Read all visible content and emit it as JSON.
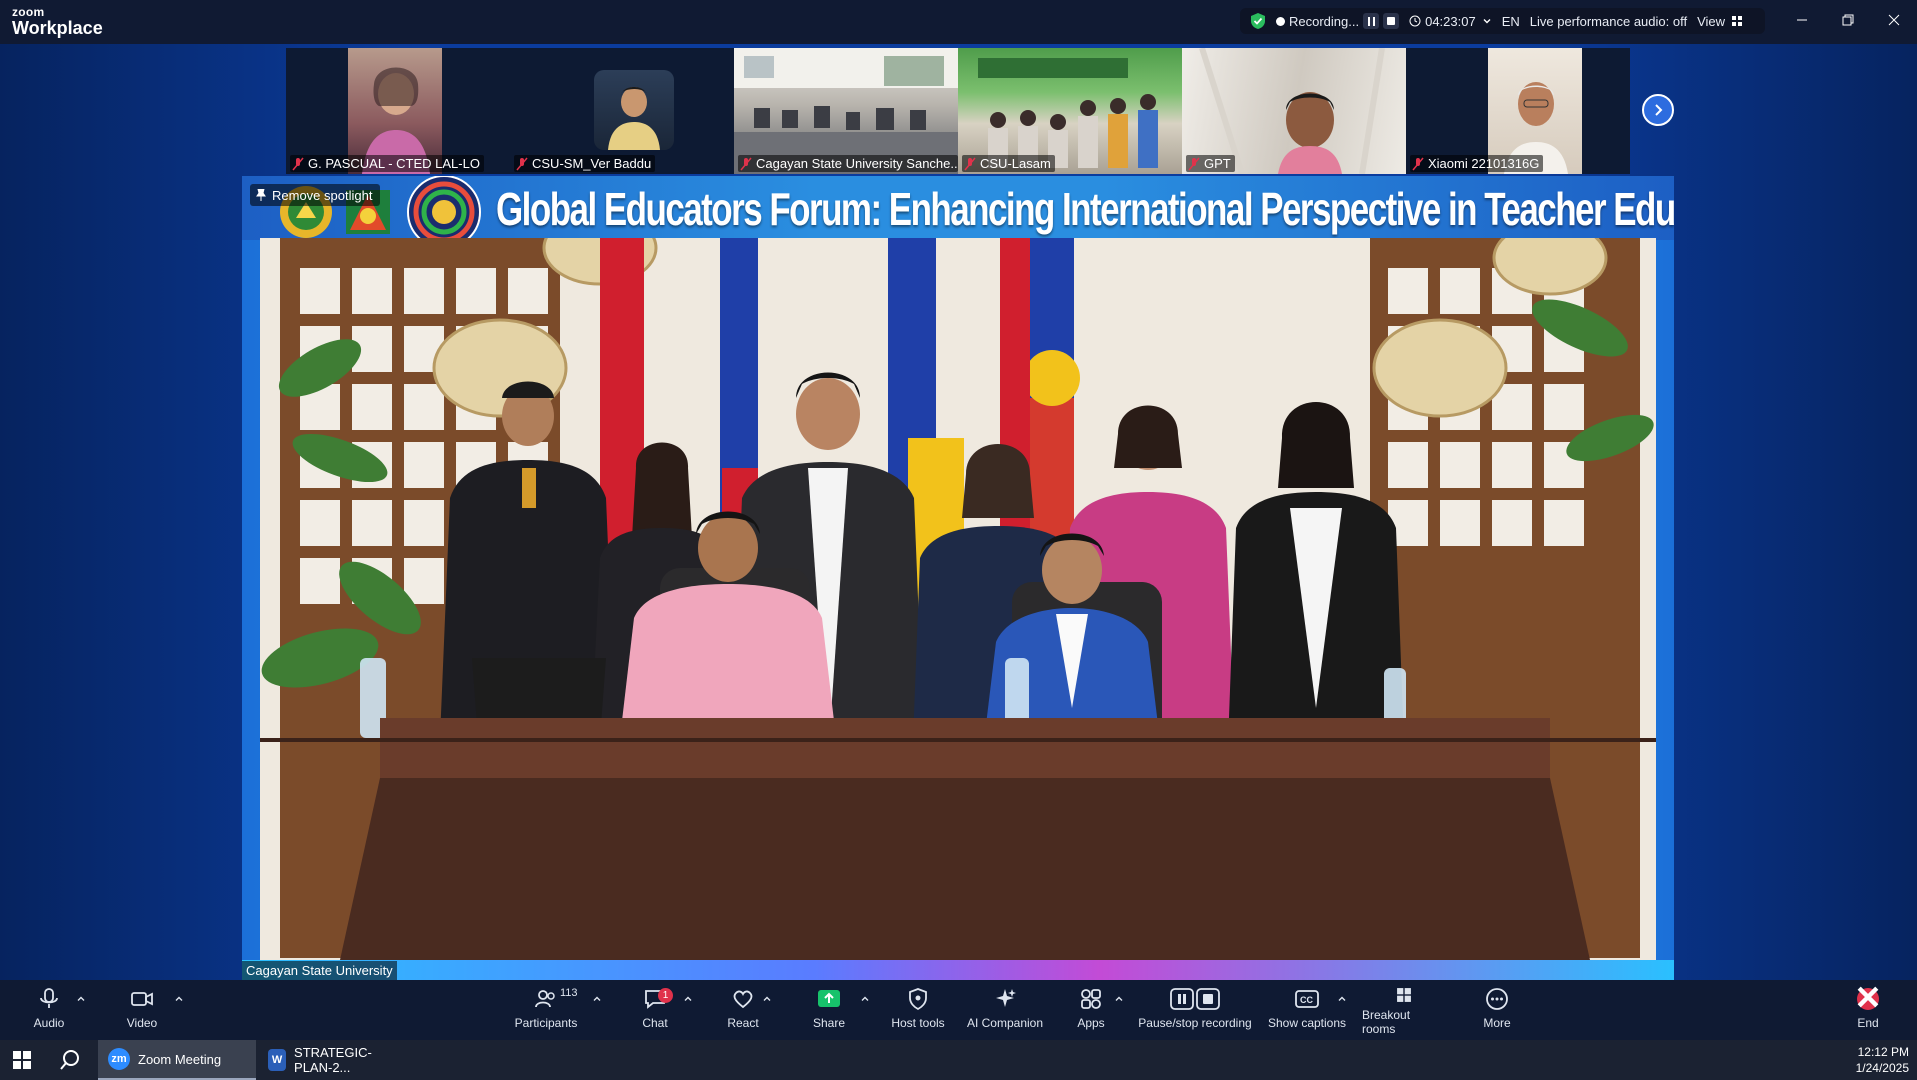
{
  "window": {
    "brand_top": "zoom",
    "brand_bottom": "Workplace"
  },
  "status": {
    "recording": "Recording...",
    "timer": "04:23:07",
    "language": "EN",
    "audio": "Live performance audio: off",
    "view": "View"
  },
  "tiles": [
    {
      "label": "G. PASCUAL - CTED LAL-LO"
    },
    {
      "label": "CSU-SM_Ver Baddu"
    },
    {
      "label": "Cagayan State University Sanche..."
    },
    {
      "label": "CSU-Lasam"
    },
    {
      "label": "GPT"
    },
    {
      "label": "Xiaomi 22101316G"
    }
  ],
  "spotlight": {
    "remove_label": "Remove spotlight",
    "banner_title": "Global Educators Forum: Enhancing International Perspective in Teacher Education",
    "name_label": "Cagayan State University"
  },
  "toolbar": {
    "audio": "Audio",
    "video": "Video",
    "participants": "Participants",
    "participants_count": "113",
    "chat": "Chat",
    "chat_badge": "1",
    "react": "React",
    "share": "Share",
    "host_tools": "Host tools",
    "ai_companion": "AI Companion",
    "apps": "Apps",
    "pause_stop": "Pause/stop recording",
    "captions": "Show captions",
    "breakout": "Breakout rooms",
    "more": "More",
    "end": "End"
  },
  "taskbar": {
    "zoom_meeting": "Zoom Meeting",
    "word_doc": "STRATEGIC-PLAN-2...",
    "time": "12:12 PM",
    "date": "1/24/2025"
  },
  "colors": {
    "accent_green": "#2bbd5e",
    "end_red": "#e0324b",
    "share_green": "#17c26b"
  }
}
